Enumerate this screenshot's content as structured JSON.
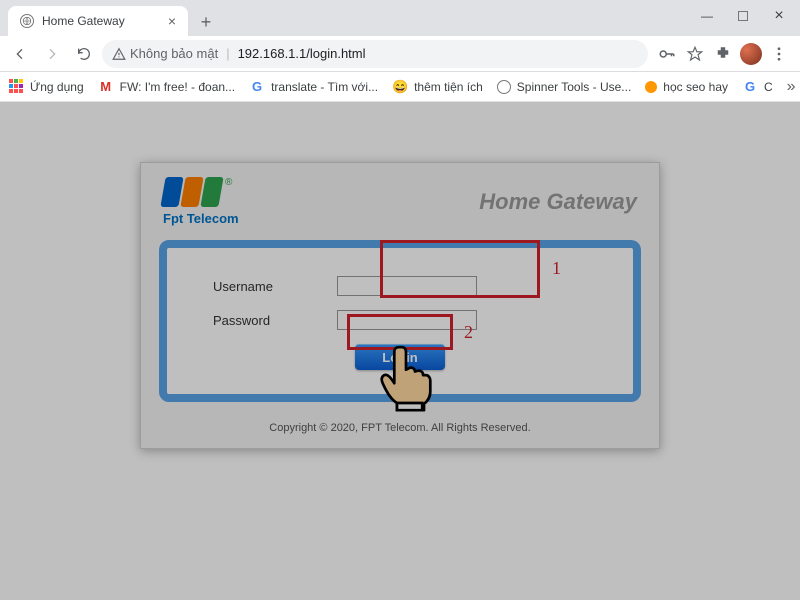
{
  "window": {
    "tab_title": "Home Gateway"
  },
  "toolbar": {
    "security_label": "Không bảo mật",
    "url": "192.168.1.1/login.html"
  },
  "bookmarks": {
    "apps": "Ứng dụng",
    "items": [
      {
        "label": "FW: I'm free! - đoan...",
        "icon": "gmail"
      },
      {
        "label": "translate - Tìm với...",
        "icon": "google"
      },
      {
        "label": "thêm tiện ích",
        "icon": "emoji"
      },
      {
        "label": "Spinner Tools - Use...",
        "icon": "globe"
      },
      {
        "label": "học seo hay",
        "icon": "dot"
      },
      {
        "label": "C",
        "icon": "google"
      }
    ]
  },
  "login": {
    "brand_sub": "Fpt Telecom",
    "title": "Home Gateway",
    "username_label": "Username",
    "password_label": "Password",
    "username_value": "",
    "password_value": "",
    "login_button": "Login",
    "footer": "Copyright © 2020, FPT Telecom. All Rights Reserved."
  },
  "annotations": {
    "box1_label": "1",
    "box2_label": "2"
  }
}
